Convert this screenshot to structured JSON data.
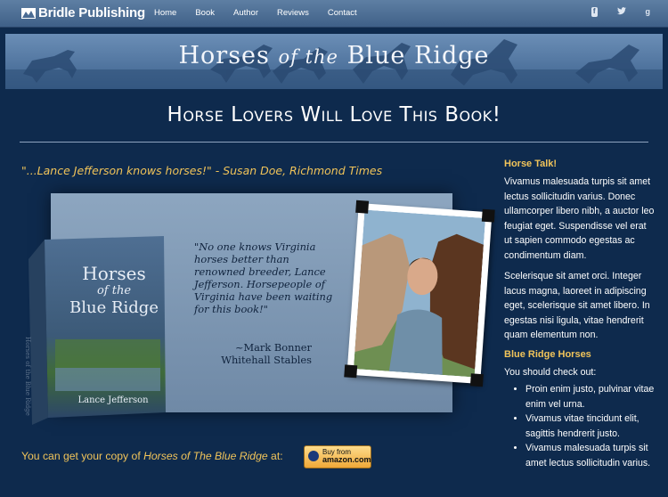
{
  "navbar": {
    "brand": "Bridle Publishing",
    "links": [
      "Home",
      "Book",
      "Author",
      "Reviews",
      "Contact"
    ],
    "social_icons": [
      "facebook-icon",
      "twitter-icon",
      "google-plus-icon"
    ],
    "social_glyphs": [
      "f",
      "t",
      "g"
    ]
  },
  "banner": {
    "title_part1": "Horses",
    "title_part2": "of the",
    "title_part3": "Blue Ridge"
  },
  "page_title": "Horse Lovers Will Love This Book!",
  "main": {
    "quote": "\"...Lance Jefferson knows horses!\" - Susan Doe, Richmond Times",
    "book_cover": {
      "line1": "Horses",
      "line2": "of the",
      "line3": "Blue Ridge",
      "author": "Lance Jefferson",
      "spine": "Horses of the Blue Ridge"
    },
    "blurb": "\"No one knows Virginia horses better than renowned breeder, Lance Jefferson. Horsepeople of Virginia have been waiting for this book!\"",
    "attribution_name": "~Mark Bonner",
    "attribution_org": "Whitehall Stables",
    "buy_prefix": "You can get your copy of ",
    "buy_title": "Horses of The Blue Ridge",
    "buy_suffix": " at:",
    "amazon_line1": "Buy from",
    "amazon_line2": "amazon.com"
  },
  "sidebar": {
    "heading1": "Horse Talk!",
    "para1": "Vivamus malesuada turpis sit amet lectus sollicitudin varius. Donec ullamcorper libero nibh, a auctor leo feugiat eget. Suspendisse vel erat ut sapien commodo egestas ac condimentum diam.",
    "para2": "Scelerisque sit amet orci. Integer lacus magna, laoreet in adipiscing eget, scelerisque sit amet libero. In egestas nisi ligula, vitae hendrerit quam elementum non.",
    "heading2": "Blue Ridge Horses",
    "para3": "You should check out:",
    "list": [
      "Proin enim justo, pulvinar vitae enim vel urna.",
      "Vivamus vitae tincidunt elit, sagittis hendrerit justo.",
      "Vivamus malesuada turpis sit amet lectus sollicitudin varius."
    ]
  },
  "colors": {
    "background": "#0e2a4d",
    "accent": "#f1c45a",
    "navbar": "#4a6b93"
  }
}
